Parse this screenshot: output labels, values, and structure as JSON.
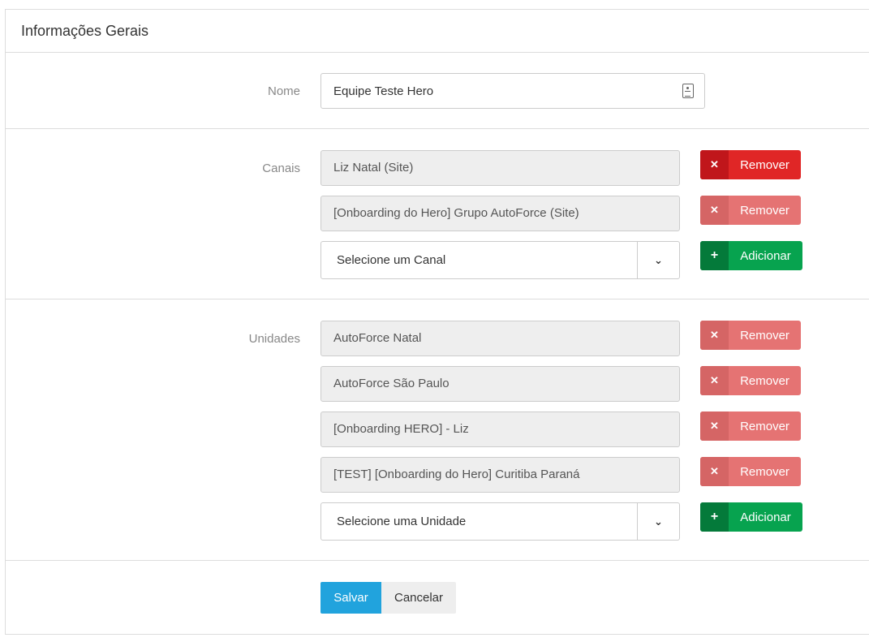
{
  "panel": {
    "title": "Informações Gerais"
  },
  "nome": {
    "label": "Nome",
    "value": "Equipe Teste Hero",
    "icon": "contact-card-icon"
  },
  "canais": {
    "label": "Canais",
    "items": [
      {
        "text": "Liz Natal (Site)",
        "button": "Remover"
      },
      {
        "text": "[Onboarding do Hero] Grupo AutoForce (Site)",
        "button": "Remover"
      }
    ],
    "select_placeholder": "Selecione um Canal",
    "add_button": "Adicionar"
  },
  "unidades": {
    "label": "Unidades",
    "items": [
      {
        "text": "AutoForce Natal",
        "button": "Remover"
      },
      {
        "text": "AutoForce São Paulo",
        "button": "Remover"
      },
      {
        "text": "[Onboarding HERO] - Liz",
        "button": "Remover"
      },
      {
        "text": "[TEST] [Onboarding do Hero] Curitiba Paraná",
        "button": "Remover"
      }
    ],
    "select_placeholder": "Selecione uma Unidade",
    "add_button": "Adicionar"
  },
  "actions": {
    "save": "Salvar",
    "cancel": "Cancelar"
  },
  "colors": {
    "remove_active": "#e02626",
    "remove_soft": "#e57373",
    "add": "#07a34f",
    "save": "#21a3dd"
  }
}
